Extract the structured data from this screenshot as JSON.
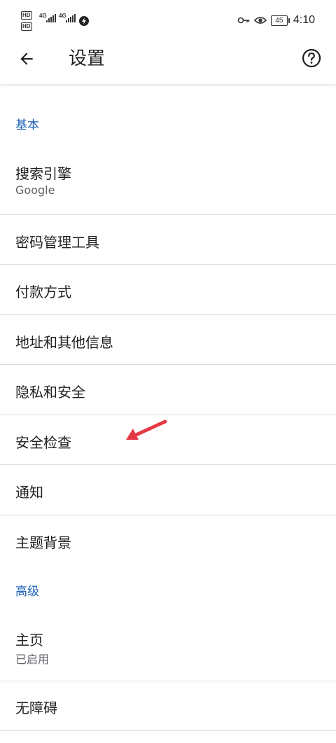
{
  "status_bar": {
    "network_badge_1": "HD",
    "network_badge_2": "HD",
    "network_type_1": "4G",
    "network_type_2": "4G",
    "battery_level": "45",
    "time": "4:10",
    "icons": [
      "vpn-key-icon",
      "eye-comfort-icon",
      "battery-icon",
      "data-saver-icon",
      "signal-icon"
    ]
  },
  "app_bar": {
    "title": "设置",
    "back_icon": "arrow-back-icon",
    "help_icon": "help-circle-icon"
  },
  "sections": {
    "basic": {
      "header": "基本",
      "items": [
        {
          "title": "搜索引擎",
          "summary": "Google"
        },
        {
          "title": "密码管理工具"
        },
        {
          "title": "付款方式"
        },
        {
          "title": "地址和其他信息"
        },
        {
          "title": "隐私和安全"
        },
        {
          "title": "安全检查"
        },
        {
          "title": "通知"
        },
        {
          "title": "主题背景"
        }
      ]
    },
    "advanced": {
      "header": "高级",
      "items": [
        {
          "title": "主页",
          "summary": "已启用"
        },
        {
          "title": "无障碍"
        }
      ]
    }
  },
  "annotation": {
    "color": "#e53946",
    "icon": "red-arrow-annotation"
  },
  "colors": {
    "accent": "#1a5fb4",
    "divider": "#dadce0",
    "text_primary": "#202124",
    "text_secondary": "#5f6368"
  }
}
